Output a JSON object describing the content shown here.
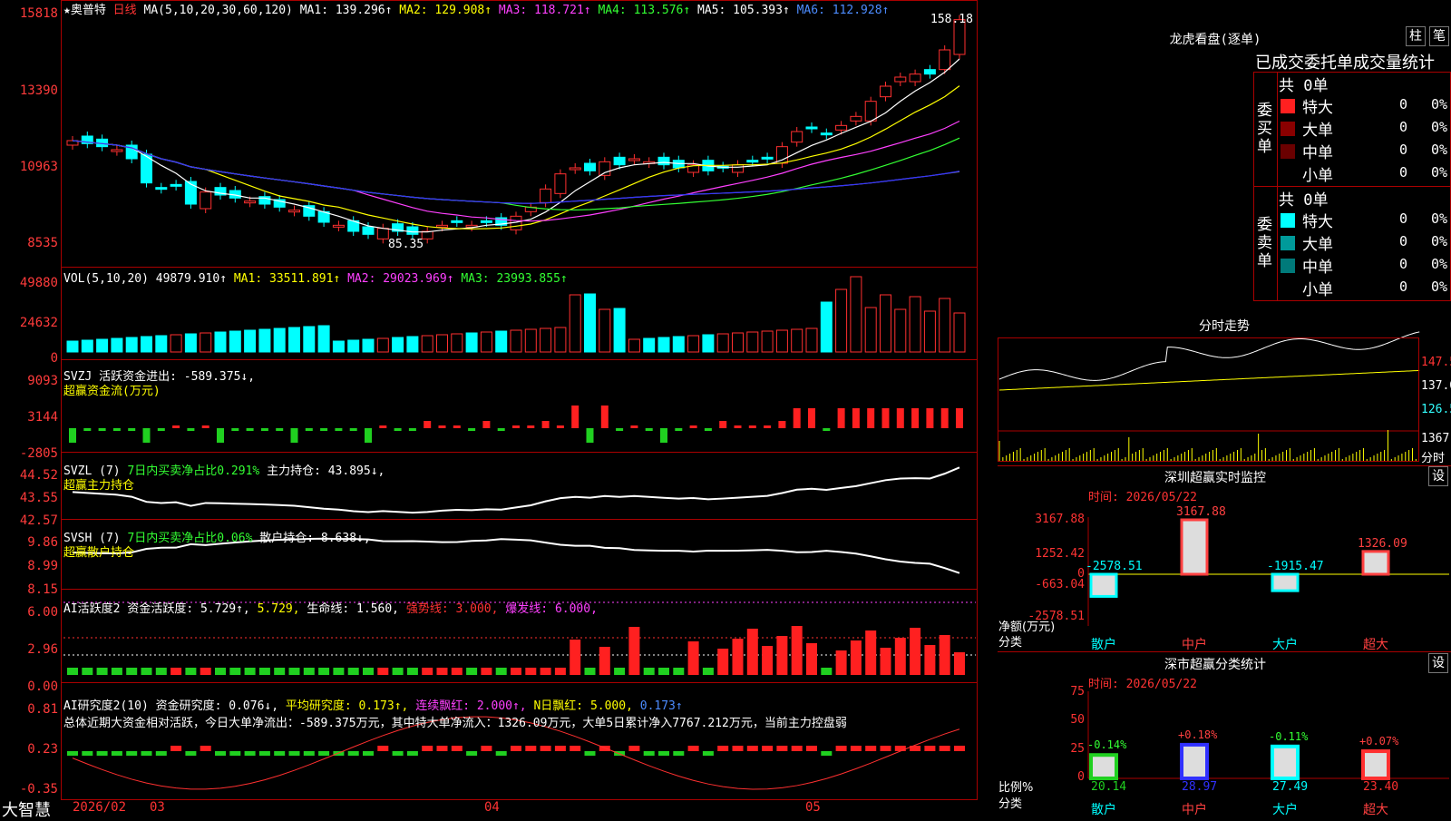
{
  "stock": {
    "star": "★",
    "name": "奥普特",
    "period": "日线"
  },
  "price_panel": {
    "ma_title": "MA(5,10,20,30,60,120)",
    "ma1": "MA1: 139.296↑",
    "ma2": "MA2: 129.908↑",
    "ma3": "MA3: 118.721↑",
    "ma4": "MA4: 113.576↑",
    "ma5": "MA5: 105.393↑",
    "ma6": "MA6: 112.928↑",
    "y_ticks": [
      "15818",
      "13390",
      "10963",
      "8535"
    ],
    "high_label": "158.18",
    "low_label": "85.35"
  },
  "vol_panel": {
    "title": "VOL(5,10,20)",
    "value": "49879.910↑",
    "ma1": "MA1: 33511.891↑",
    "ma2": "MA2: 29023.969↑",
    "ma3": "MA3: 23993.855↑",
    "y_ticks": [
      "49880",
      "24632",
      "0"
    ]
  },
  "svzj_panel": {
    "title": "SVZJ",
    "desc": "活跃资金进出: -589.375↓,",
    "sub": "超赢资金流(万元)",
    "y_ticks": [
      "9093",
      "3144",
      "-2805"
    ]
  },
  "svzl_panel": {
    "title": "SVZL (7)",
    "desc": "7日内买卖净占比0.291%",
    "val": "主力持仓: 43.895↓,",
    "sub": "超赢主力持仓",
    "y_ticks": [
      "44.52",
      "43.55",
      "42.57"
    ]
  },
  "svsh_panel": {
    "title": "SVSH (7)",
    "desc": "7日内买卖净占比0.06%",
    "val": "散户持仓: 8.638↓,",
    "sub": "超赢散户持仓",
    "y_ticks": [
      "9.86",
      "8.99",
      "8.15"
    ]
  },
  "ai1_panel": {
    "title": "AI活跃度2",
    "v1": "资金活跃度: 5.729↑,",
    "v2": "5.729,",
    "v3": "生命线: 1.560,",
    "v4": "强势线: 3.000,",
    "v5": "爆发线: 6.000,",
    "y_ticks": [
      "6.00",
      "2.96",
      "0.00"
    ]
  },
  "ai2_panel": {
    "title": "AI研究度2(10)",
    "v1": "资金研究度: 0.076↓,",
    "v2": "平均研究度: 0.173↑,",
    "v3": "连续飘红: 2.000↑,",
    "v4": "N日飘红: 5.000,",
    "v5": "0.173↑",
    "summary": "总体近期大资金相对活跃，今日大单净流出：-589.375万元，其中特大单净流入：1326.09万元，大单5日累计净入7767.212万元，当前主力控盘弱",
    "y_ticks": [
      "0.81",
      "0.23",
      "-0.35"
    ]
  },
  "bottom_bar": {
    "brand": "大智慧",
    "dates": [
      "2026/02",
      "03",
      "04",
      "05"
    ]
  },
  "dragon": {
    "title": "龙虎看盘(逐单)",
    "btn1": "柱",
    "btn2": "笔",
    "header": "已成交委托单成交量统计",
    "buy_label": "委买单",
    "sell_label": "委卖单",
    "buy_total": "共 0单",
    "sell_total": "共 0单",
    "buy_rows": [
      {
        "name": "特大",
        "n": "0",
        "p": "0%",
        "color": "#ff2020"
      },
      {
        "name": "大单",
        "n": "0",
        "p": "0%",
        "color": "#8a0000"
      },
      {
        "name": "中单",
        "n": "0",
        "p": "0%",
        "color": "#6a0000"
      },
      {
        "name": "小单",
        "n": "0",
        "p": "0%",
        "color": ""
      }
    ],
    "sell_rows": [
      {
        "name": "特大",
        "n": "0",
        "p": "0%",
        "color": "#00ffff"
      },
      {
        "name": "大单",
        "n": "0",
        "p": "0%",
        "color": "#009a9a"
      },
      {
        "name": "中单",
        "n": "0",
        "p": "0%",
        "color": "#007a7a"
      },
      {
        "name": "小单",
        "n": "0",
        "p": "0%",
        "color": ""
      }
    ]
  },
  "intraday": {
    "title": "分时走势",
    "y_ticks": [
      "147.5",
      "137.0",
      "126.5",
      "1367"
    ],
    "tag": "分时"
  },
  "sz_monitor": {
    "title": "深圳超赢实时监控",
    "btn": "设",
    "time": "时间: 2026/05/22",
    "y_ticks": [
      "3167.88",
      "1252.42",
      "0",
      "-663.04",
      "-2578.51"
    ],
    "unit": "净额(万元)",
    "cat_tag": "分类",
    "chart_data": {
      "type": "bar",
      "categories": [
        "散户",
        "中户",
        "大户",
        "超大"
      ],
      "values": [
        -2578.51,
        3167.88,
        -1915.47,
        1326.09
      ],
      "ylim": [
        -2578.51,
        3167.88
      ]
    },
    "labels": [
      "-2578.51",
      "3167.88",
      "-1915.47",
      "1326.09"
    ]
  },
  "sz_class": {
    "title": "深市超赢分类统计",
    "btn": "设",
    "time": "时间: 2026/05/22",
    "y_ticks": [
      "75",
      "50",
      "25",
      "0"
    ],
    "unit": "比例%",
    "cat_tag": "分类",
    "chart_data": {
      "type": "bar",
      "categories": [
        "散户",
        "中户",
        "大户",
        "超大"
      ],
      "values": [
        20.14,
        28.97,
        27.49,
        23.4
      ],
      "changes": [
        "-0.14%",
        "+0.18%",
        "-0.11%",
        "+0.07%"
      ],
      "ylim": [
        0,
        75
      ]
    }
  }
}
